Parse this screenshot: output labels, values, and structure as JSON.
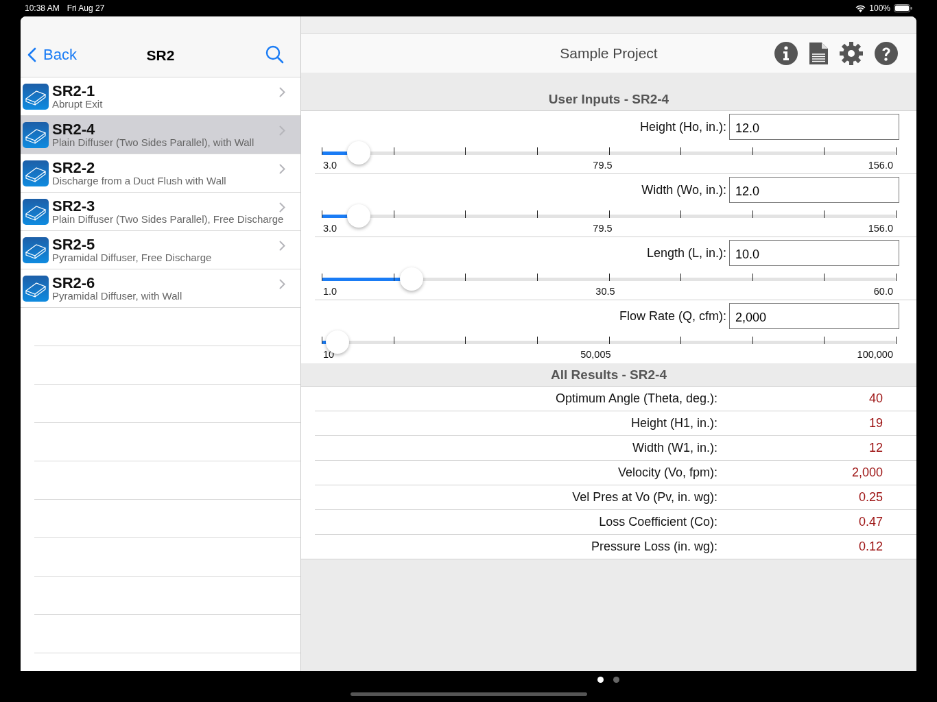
{
  "status_bar": {
    "time": "10:38 AM",
    "date": "Fri Aug 27",
    "battery": "100%"
  },
  "sidebar": {
    "back": "Back",
    "title": "SR2",
    "items": [
      {
        "code": "SR2-1",
        "description": "Abrupt Exit",
        "selected": false
      },
      {
        "code": "SR2-4",
        "description": "Plain Diffuser (Two Sides Parallel), with Wall",
        "selected": true
      },
      {
        "code": "SR2-2",
        "description": "Discharge from a Duct Flush with Wall",
        "selected": false
      },
      {
        "code": "SR2-3",
        "description": "Plain Diffuser (Two Sides Parallel), Free Discharge",
        "selected": false
      },
      {
        "code": "SR2-5",
        "description": "Pyramidal Diffuser, Free Discharge",
        "selected": false
      },
      {
        "code": "SR2-6",
        "description": "Pyramidal Diffuser, with Wall",
        "selected": false
      }
    ]
  },
  "header": {
    "title": "Sample Project"
  },
  "inputs": {
    "title": "User Inputs - SR2-4",
    "fields": [
      {
        "label": "Height (Ho, in.):",
        "value": "12.0",
        "level": 0.065,
        "min": "3.0",
        "mid": "79.5",
        "max": "156.0"
      },
      {
        "label": "Width (Wo, in.):",
        "value": "12.0",
        "level": 0.065,
        "min": "3.0",
        "mid": "79.5",
        "max": "156.0"
      },
      {
        "label": "Length (L, in.):",
        "value": "10.0",
        "level": 0.157,
        "min": "1.0",
        "mid": "30.5",
        "max": "60.0"
      },
      {
        "label": "Flow Rate (Q, cfm):",
        "value": "2,000",
        "level": 0.027,
        "min": "10",
        "mid": "50,005",
        "max": "100,000"
      }
    ]
  },
  "results": {
    "title": "All Results - SR2-4",
    "rows": [
      {
        "label": "Optimum Angle (Theta, deg.):",
        "value": "40"
      },
      {
        "label": "Height (H1, in.):",
        "value": "19"
      },
      {
        "label": "Width  (W1, in.):",
        "value": "12"
      },
      {
        "label": "Velocity (Vo, fpm):",
        "value": "2,000"
      },
      {
        "label": "Vel Pres at Vo (Pv, in. wg):",
        "value": "0.25"
      },
      {
        "label": "Loss Coefficient (Co):",
        "value": "0.47"
      },
      {
        "label": "Pressure Loss (in. wg):",
        "value": "0.12"
      }
    ]
  },
  "page_dots": [
    {
      "selected": true
    },
    {
      "selected": false
    }
  ]
}
